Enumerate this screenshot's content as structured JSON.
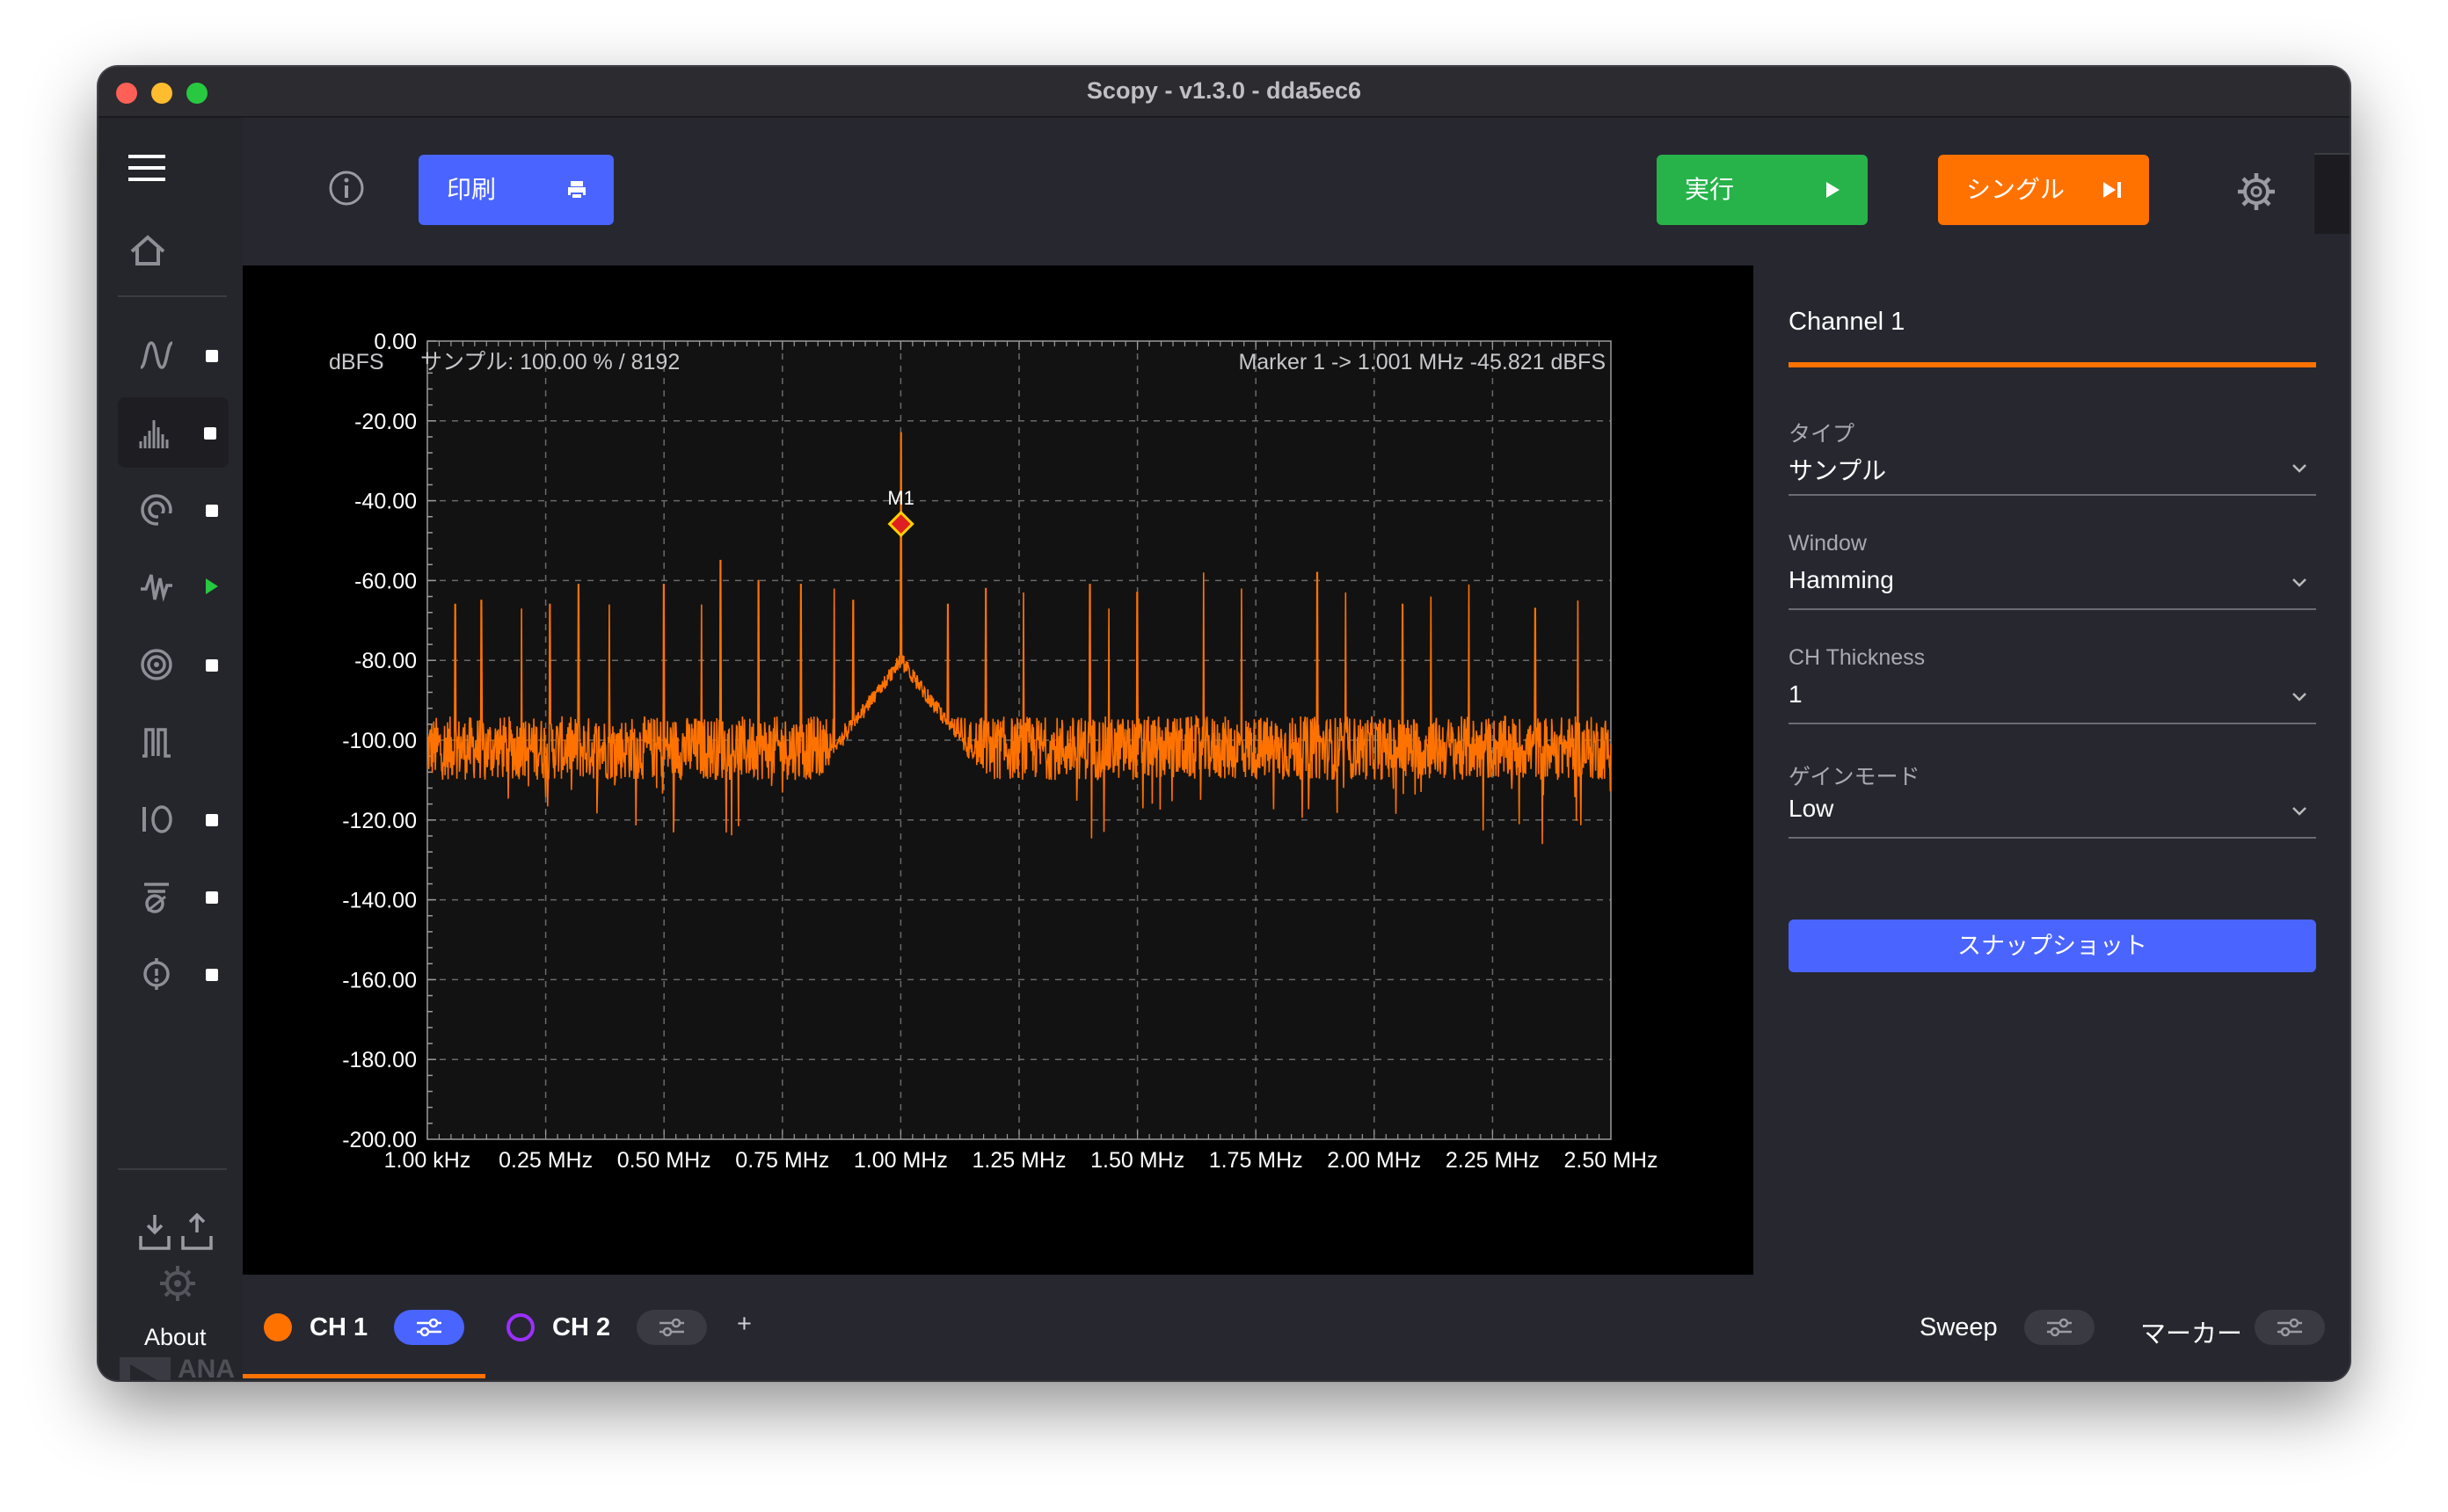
{
  "window": {
    "title": "Scopy - v1.3.0 - dda5ec6"
  },
  "toolbar": {
    "print_label": "印刷",
    "run_label": "実行",
    "single_label": "シングル"
  },
  "sidebar": {
    "items": [
      {
        "icon": "oscilloscope-icon",
        "indicator": "stopped"
      },
      {
        "icon": "spectrum-analyzer-icon",
        "indicator": "stopped",
        "active": true
      },
      {
        "icon": "network-analyzer-icon",
        "indicator": "stopped"
      },
      {
        "icon": "signal-generator-icon",
        "indicator": "running"
      },
      {
        "icon": "voltmeter-icon",
        "indicator": "stopped"
      },
      {
        "icon": "power-supply-icon",
        "indicator": "none"
      },
      {
        "icon": "digital-io-icon",
        "indicator": "stopped"
      },
      {
        "icon": "logic-analyzer-icon",
        "indicator": "stopped"
      },
      {
        "icon": "calibration-icon",
        "indicator": "stopped"
      }
    ],
    "about_label": "About",
    "logo_text": "ANALOG DEVICES"
  },
  "plot": {
    "unit_label": "dBFS",
    "sample_info": "サンプル: 100.00 % / 8192",
    "marker_info": "Marker 1 -> 1.001 MHz -45.821 dBFS",
    "marker_label": "M1"
  },
  "chart_data": {
    "type": "line",
    "title": "",
    "xlabel": "",
    "ylabel": "dBFS",
    "xlim_mhz": [
      0.001,
      2.5
    ],
    "ylim": [
      -200,
      0
    ],
    "y_ticks": [
      "0.00",
      "-20.00",
      "-40.00",
      "-60.00",
      "-80.00",
      "-100.00",
      "-120.00",
      "-140.00",
      "-160.00",
      "-180.00",
      "-200.00"
    ],
    "x_ticks": [
      "1.00 kHz",
      "0.25 MHz",
      "0.50 MHz",
      "0.75 MHz",
      "1.00 MHz",
      "1.25 MHz",
      "1.50 MHz",
      "1.75 MHz",
      "2.00 MHz",
      "2.25 MHz",
      "2.50 MHz"
    ],
    "grid": true,
    "series": [
      {
        "color": "#ff7200",
        "noise_floor_db": -102,
        "carrier": {
          "freq_mhz": 1.001,
          "level_db": -23
        },
        "spurs": [
          {
            "freq_mhz": 0.06,
            "level_db": -66
          },
          {
            "freq_mhz": 0.115,
            "level_db": -65
          },
          {
            "freq_mhz": 0.2,
            "level_db": -67
          },
          {
            "freq_mhz": 0.26,
            "level_db": -66
          },
          {
            "freq_mhz": 0.32,
            "level_db": -61
          },
          {
            "freq_mhz": 0.385,
            "level_db": -66
          },
          {
            "freq_mhz": 0.5,
            "level_db": -61
          },
          {
            "freq_mhz": 0.58,
            "level_db": -66
          },
          {
            "freq_mhz": 0.62,
            "level_db": -55
          },
          {
            "freq_mhz": 0.7,
            "level_db": -60
          },
          {
            "freq_mhz": 0.79,
            "level_db": -61
          },
          {
            "freq_mhz": 0.86,
            "level_db": -62
          },
          {
            "freq_mhz": 0.9,
            "level_db": -65
          },
          {
            "freq_mhz": 1.1,
            "level_db": -66
          },
          {
            "freq_mhz": 1.18,
            "level_db": -62
          },
          {
            "freq_mhz": 1.26,
            "level_db": -63
          },
          {
            "freq_mhz": 1.4,
            "level_db": -61
          },
          {
            "freq_mhz": 1.44,
            "level_db": -67
          },
          {
            "freq_mhz": 1.5,
            "level_db": -63
          },
          {
            "freq_mhz": 1.64,
            "level_db": -58
          },
          {
            "freq_mhz": 1.72,
            "level_db": -62
          },
          {
            "freq_mhz": 1.88,
            "level_db": -58
          },
          {
            "freq_mhz": 1.94,
            "level_db": -63
          },
          {
            "freq_mhz": 2.06,
            "level_db": -66
          },
          {
            "freq_mhz": 2.12,
            "level_db": -64
          },
          {
            "freq_mhz": 2.2,
            "level_db": -61
          },
          {
            "freq_mhz": 2.34,
            "level_db": -67
          },
          {
            "freq_mhz": 2.43,
            "level_db": -65
          }
        ]
      }
    ],
    "marker": {
      "name": "M1",
      "freq_mhz": 1.001,
      "level_db": -45.821
    }
  },
  "right_panel": {
    "title": "Channel 1",
    "fields": [
      {
        "label": "タイプ",
        "value": "サンプル"
      },
      {
        "label": "Window",
        "value": "Hamming"
      },
      {
        "label": "CH Thickness",
        "value": "1"
      },
      {
        "label": "ゲインモード",
        "value": "Low"
      }
    ],
    "snapshot_label": "スナップショット"
  },
  "bottom": {
    "ch1_label": "CH 1",
    "ch2_label": "CH 2",
    "add_label": "+",
    "sweep_label": "Sweep",
    "marker_label": "マーカー",
    "colors": {
      "ch1": "#ff7200",
      "ch2": "#9b30ff",
      "accent": "#4a64ff",
      "run": "#27b34a",
      "single": "#ff7200"
    }
  }
}
